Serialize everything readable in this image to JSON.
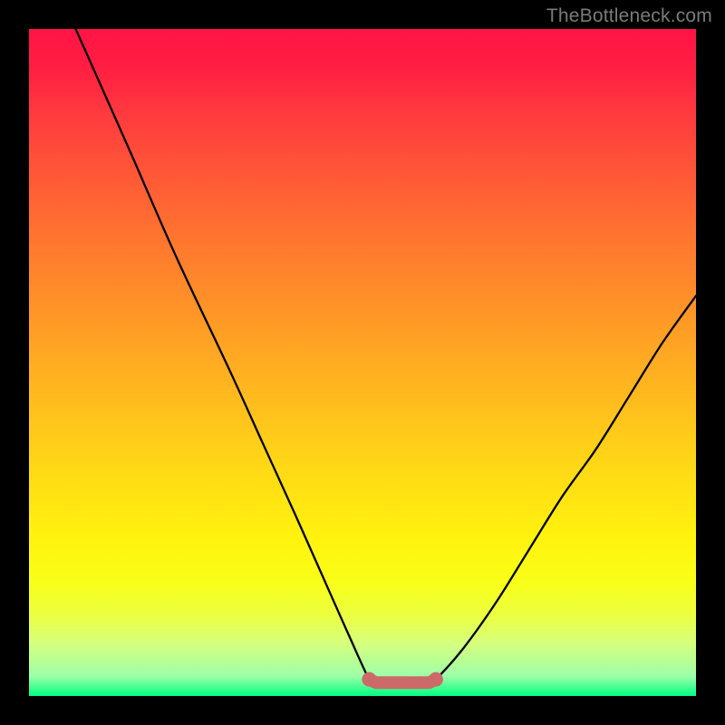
{
  "attribution": "TheBottleneck.com",
  "chart_data": {
    "type": "line",
    "title": "",
    "xlabel": "",
    "ylabel": "",
    "xlim": [
      0,
      100
    ],
    "ylim": [
      0,
      100
    ],
    "series": [
      {
        "name": "curve",
        "x": [
          7,
          15,
          22,
          30,
          35,
          40,
          44,
          48,
          51,
          52,
          55,
          58,
          60,
          61,
          65,
          70,
          75,
          80,
          85,
          90,
          95,
          100
        ],
        "y": [
          100,
          82,
          66,
          49,
          38,
          27,
          18,
          9,
          2.5,
          2,
          2,
          2,
          2,
          2.5,
          7,
          14,
          22,
          30,
          37,
          45,
          53,
          60
        ]
      }
    ],
    "highlight": {
      "name": "bottom-plateau-marker",
      "color": "#cc6969",
      "points_x": [
        51,
        52,
        53.5,
        55,
        56.5,
        58,
        60,
        61
      ],
      "points_y": [
        2.5,
        2,
        2,
        2,
        2,
        2,
        2,
        2.5
      ]
    },
    "background_gradient": {
      "stops": [
        {
          "pos": 0,
          "color": "#ff1446"
        },
        {
          "pos": 100,
          "color": "#00ff82"
        }
      ],
      "orientation": "vertical"
    }
  }
}
